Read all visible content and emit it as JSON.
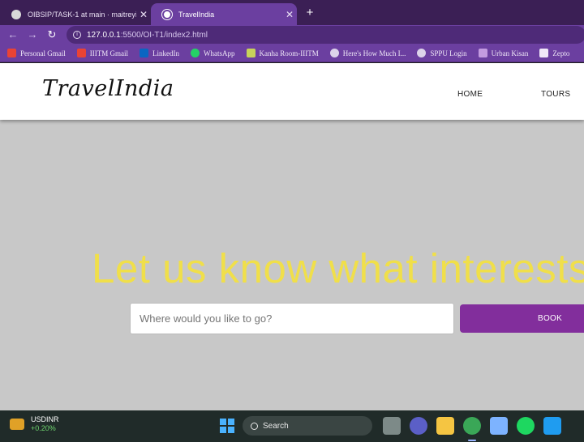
{
  "browser": {
    "tabs": [
      {
        "title": "OIBSIP/TASK-1 at main · maitreyi",
        "close": "✕",
        "icon": "github-icon"
      },
      {
        "title": "TravelIndia",
        "close": "✕",
        "icon": "globe-icon"
      }
    ],
    "new_tab": "+",
    "back": "←",
    "forward": "→",
    "reload": "↻",
    "url_host": "127.0.0.1",
    "url_path": ":5500/OI-T1/index2.html",
    "bookmarks": [
      {
        "label": "Personal Gmail",
        "icon": "gmail-icon",
        "color": "#ea4335"
      },
      {
        "label": "IIITM Gmail",
        "icon": "gmail-icon",
        "color": "#ea4335"
      },
      {
        "label": "LinkedIn",
        "icon": "linkedin-icon",
        "color": "#0a66c2"
      },
      {
        "label": "WhatsApp",
        "icon": "whatsapp-icon",
        "color": "#25d366"
      },
      {
        "label": "Kanha Room-IIITM",
        "icon": "maps-icon",
        "color": "#c7d35a"
      },
      {
        "label": "Here's How Much I...",
        "icon": "globe-icon",
        "color": "#dcd3ea"
      },
      {
        "label": "SPPU Login",
        "icon": "globe-icon",
        "color": "#dcd3ea"
      },
      {
        "label": "Urban Kisan",
        "icon": "urban-kisan-icon",
        "color": "#c39be0"
      },
      {
        "label": "Zepto",
        "icon": "zepto-icon",
        "color": "#f0e8f8"
      }
    ]
  },
  "page": {
    "logo": "TravelIndia",
    "nav": [
      "HOME",
      "TOURS"
    ],
    "hero_title": "Let us know what interests you",
    "search_placeholder": "Where would you like to go?",
    "book_label": "BOOK",
    "colors": {
      "hero_text": "#f0df4a",
      "button": "#822e9c",
      "background": "#c8c8c8"
    }
  },
  "taskbar": {
    "ticker_name": "USDINR",
    "ticker_change": "+0.20%",
    "search_label": "Search",
    "apps": [
      {
        "name": "task-view-icon",
        "color": "#7d8a88"
      },
      {
        "name": "teams-icon",
        "color": "#5b5fc7"
      },
      {
        "name": "file-explorer-icon",
        "color": "#f5c542"
      },
      {
        "name": "chrome-icon",
        "color": "#3aa757"
      },
      {
        "name": "snipping-tool-icon",
        "color": "#7db3ff"
      },
      {
        "name": "spotify-icon",
        "color": "#1ed760"
      },
      {
        "name": "vscode-icon",
        "color": "#1f9cf0"
      }
    ]
  }
}
